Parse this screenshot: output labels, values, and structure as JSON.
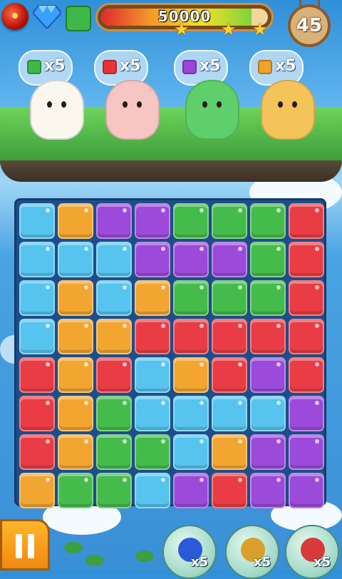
{
  "hud": {
    "score": "50000",
    "score_progress": 0.9,
    "stars_earned": 3,
    "moves_left": "45",
    "goal_color": "#3fb84a"
  },
  "creatures": [
    {
      "name_icon": "sheep",
      "request_color": "#3fb84a",
      "request_text": "x5"
    },
    {
      "name_icon": "pig",
      "request_color": "#e8333a",
      "request_text": "x5"
    },
    {
      "name_icon": "snake",
      "request_color": "#9a45d8",
      "request_text": "x5"
    },
    {
      "name_icon": "cow",
      "request_color": "#f0a22a",
      "request_text": "x5"
    }
  ],
  "colors": {
    "B": "#56c4ee",
    "O": "#f2a530",
    "P": "#9b4ad9",
    "G": "#45bb4c",
    "R": "#ea3c44"
  },
  "board": [
    [
      "B",
      "O",
      "P",
      "P",
      "G",
      "G",
      "G",
      "R"
    ],
    [
      "B",
      "B",
      "B",
      "P",
      "P",
      "P",
      "G",
      "R"
    ],
    [
      "B",
      "O",
      "B",
      "O",
      "G",
      "G",
      "G",
      "R"
    ],
    [
      "B",
      "O",
      "O",
      "R",
      "R",
      "R",
      "R",
      "R"
    ],
    [
      "R",
      "O",
      "R",
      "B",
      "O",
      "R",
      "P",
      "R"
    ],
    [
      "R",
      "O",
      "G",
      "B",
      "B",
      "B",
      "B",
      "P"
    ],
    [
      "R",
      "O",
      "G",
      "G",
      "B",
      "O",
      "P",
      "P"
    ],
    [
      "O",
      "G",
      "G",
      "B",
      "P",
      "R",
      "P",
      "P"
    ]
  ],
  "boosters": [
    {
      "icon": "blue-bomb-icon",
      "count": "x5"
    },
    {
      "icon": "butterfly-icon",
      "count": "x5"
    },
    {
      "icon": "shuffle-icon",
      "count": "x5"
    }
  ]
}
